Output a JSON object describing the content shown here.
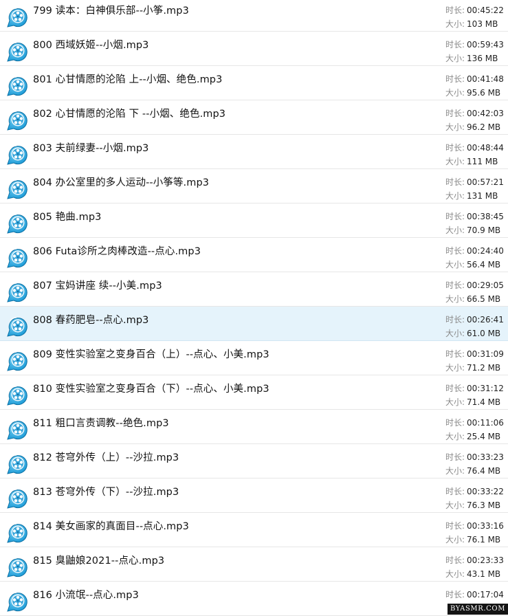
{
  "labels": {
    "duration": "时长:",
    "size": "大小:"
  },
  "files": [
    {
      "name": "799 读本：白神俱乐部--小筝.mp3",
      "duration": "00:45:22",
      "size": "103 MB"
    },
    {
      "name": "800 西域妖姬--小烟.mp3",
      "duration": "00:59:43",
      "size": "136 MB"
    },
    {
      "name": "801 心甘情愿的沦陷 上--小烟、绝色.mp3",
      "duration": "00:41:48",
      "size": "95.6 MB"
    },
    {
      "name": "802 心甘情愿的沦陷 下 --小烟、绝色.mp3",
      "duration": "00:42:03",
      "size": "96.2 MB"
    },
    {
      "name": "803 夫前绿妻--小烟.mp3",
      "duration": "00:48:44",
      "size": "111 MB"
    },
    {
      "name": "804 办公室里的多人运动--小筝等.mp3",
      "duration": "00:57:21",
      "size": "131 MB"
    },
    {
      "name": "805 艳曲.mp3",
      "duration": "00:38:45",
      "size": "70.9 MB"
    },
    {
      "name": "806 Futa诊所之肉棒改造--点心.mp3",
      "duration": "00:24:40",
      "size": "56.4 MB"
    },
    {
      "name": "807 宝妈讲座 续--小美.mp3",
      "duration": "00:29:05",
      "size": "66.5 MB"
    },
    {
      "name": "808 春药肥皂--点心.mp3",
      "duration": "00:26:41",
      "size": "61.0 MB",
      "selected": true
    },
    {
      "name": "809 变性实验室之变身百合（上）--点心、小美.mp3",
      "duration": "00:31:09",
      "size": "71.2 MB"
    },
    {
      "name": "810 变性实验室之变身百合（下）--点心、小美.mp3",
      "duration": "00:31:12",
      "size": "71.4 MB"
    },
    {
      "name": "811 粗口言责调教--绝色.mp3",
      "duration": "00:11:06",
      "size": "25.4 MB"
    },
    {
      "name": "812 苍穹外传（上）--沙拉.mp3",
      "duration": "00:33:23",
      "size": "76.4 MB"
    },
    {
      "name": "813 苍穹外传（下）--沙拉.mp3",
      "duration": "00:33:22",
      "size": "76.3 MB"
    },
    {
      "name": "814 美女画家的真面目--点心.mp3",
      "duration": "00:33:16",
      "size": "76.1 MB"
    },
    {
      "name": "815 臭鼬娘2021--点心.mp3",
      "duration": "00:23:33",
      "size": "43.1 MB"
    },
    {
      "name": "816 小流氓--点心.mp3",
      "duration": "00:17:04",
      "size": ""
    }
  ],
  "icon": "media-player-icon",
  "colors": {
    "selected_bg": "#e5f3fb",
    "icon_blue": "#1a9ad6",
    "icon_light": "#7fd3f5"
  },
  "watermark": "BYASMR.COM"
}
